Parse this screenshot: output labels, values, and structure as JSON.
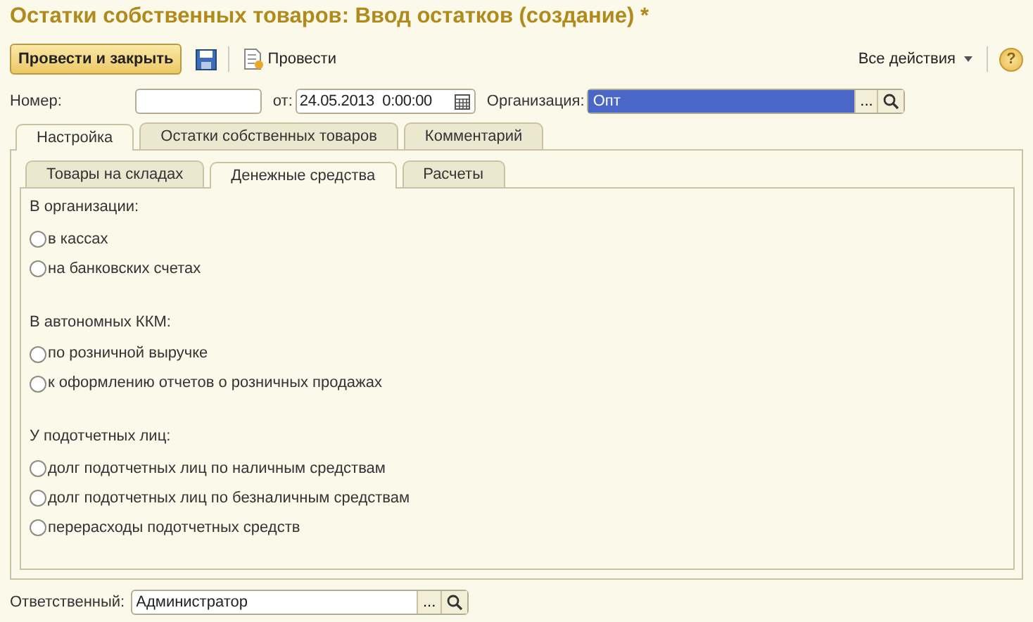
{
  "window": {
    "title": "Остатки собственных товаров: Ввод остатков (создание) *"
  },
  "toolbar": {
    "primary_button": "Провести и закрыть",
    "post_button": "Провести",
    "all_actions": "Все действия",
    "help": "?"
  },
  "header_fields": {
    "number": {
      "label": "Номер:"
    },
    "date": {
      "label": "от:",
      "value": "24.05.2013  0:00:00"
    },
    "organization": {
      "label": "Организация:",
      "value": "Опт",
      "highlighted": true,
      "choice_button": "..."
    }
  },
  "outer_tabs": [
    {
      "label": "Настройка",
      "selected": true
    },
    {
      "label": "Остатки собственных товаров",
      "selected": false
    },
    {
      "label": "Комментарий",
      "selected": false
    }
  ],
  "inner_tabs": [
    {
      "label": "Товары на складах",
      "selected": false
    },
    {
      "label": "Денежные средства",
      "selected": true
    },
    {
      "label": "Расчеты",
      "selected": false
    }
  ],
  "groups": [
    {
      "title": "В организации:",
      "options": [
        {
          "label": "в кассах",
          "selected": false
        },
        {
          "label": "на банковских счетах",
          "selected": false
        }
      ]
    },
    {
      "title": "В автономных ККМ:",
      "options": [
        {
          "label": "по розничной выручке",
          "selected": false
        },
        {
          "label": "к оформлению отчетов о розничных продажах",
          "selected": false
        }
      ]
    },
    {
      "title": "У подотчетных лиц:",
      "options": [
        {
          "label": "долг подотчетных лиц по наличным средствам",
          "selected": false
        },
        {
          "label": "долг подотчетных лиц по безналичным средствам",
          "selected": false
        },
        {
          "label": "перерасходы подотчетных средств",
          "selected": false
        }
      ]
    }
  ],
  "responsible": {
    "label": "Ответственный:",
    "value": "Администратор",
    "choice_button": "..."
  }
}
